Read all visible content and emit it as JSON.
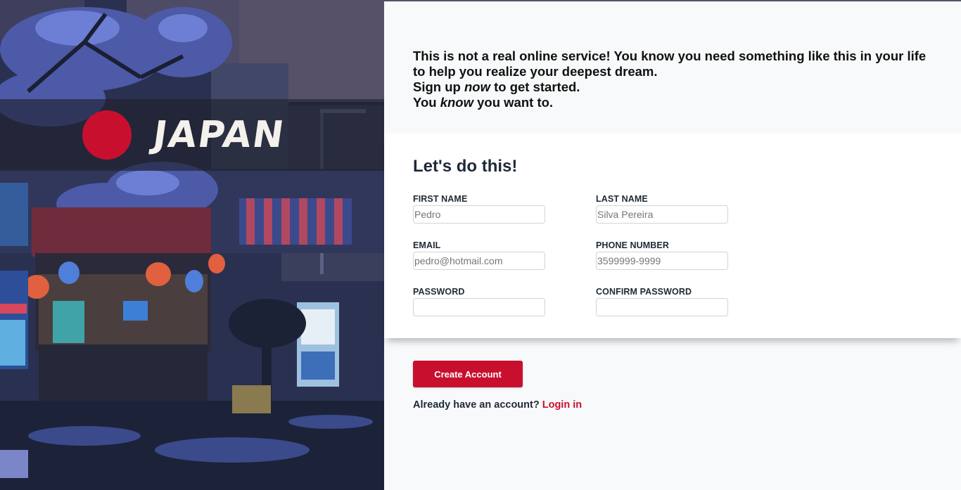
{
  "brand": {
    "logo_text": "JAPAN",
    "accent_color": "#c8102e"
  },
  "intro": {
    "line1": "This is not a real online service! You know you need something like this in your life to help you realize your deepest dream.",
    "line2_pre": "Sign up ",
    "line2_em": "now",
    "line2_post": " to get started.",
    "line3_pre": "You ",
    "line3_em": "know",
    "line3_post": " you want to."
  },
  "form": {
    "title": "Let's do this!",
    "first_name": {
      "label": "FIRST NAME",
      "placeholder": "Pedro"
    },
    "last_name": {
      "label": "LAST NAME",
      "placeholder": "Silva Pereira"
    },
    "email": {
      "label": "EMAIL",
      "placeholder": "pedro@hotmail.com"
    },
    "phone": {
      "label": "PHONE NUMBER",
      "placeholder": "3599999-9999"
    },
    "password": {
      "label": "PASSWORD",
      "placeholder": ""
    },
    "confirm_password": {
      "label": "CONFIRM PASSWORD",
      "placeholder": ""
    }
  },
  "actions": {
    "create_label": "Create Account",
    "login_prompt": "Already have an account?",
    "login_link": "Login in"
  }
}
